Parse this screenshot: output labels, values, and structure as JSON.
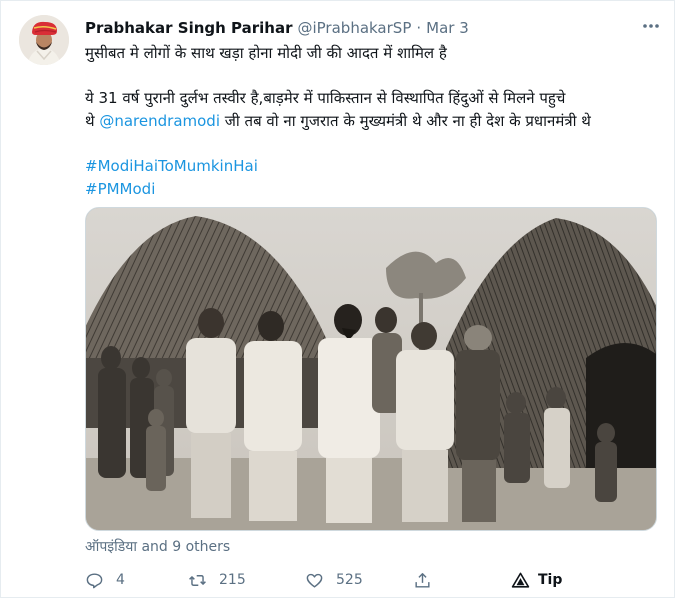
{
  "tweet": {
    "author_name": "Prabhakar Singh Parihar",
    "handle": "@iPrabhakarSP",
    "separator": "·",
    "date": "Mar 3",
    "text_line1": "मुसीबत मे लोगों के साथ खड़ा होना मोदी जी की आदत में शामिल है",
    "text_line2": "ये 31 वर्ष पुरानी दुर्लभ तस्वीर है,बाड़मेर में पाकिस्तान से विस्थापित हिंदुओं से मिलने पहुचे",
    "text_line3_prefix": "थे ",
    "mention": "@narendramodi",
    "text_line3_suffix": " जी तब वो ना गुजरात के मुख्यमंत्री थे और ना ही देश के प्रधानमंत्री थे",
    "hashtags": [
      "#ModiHaiToMumkinHai",
      "#PMModi"
    ],
    "tagged": "ऑपइंडिया and 9 others"
  },
  "actions": {
    "reply_count": "4",
    "retweet_count": "215",
    "like_count": "525",
    "tip_label": "Tip"
  },
  "icons": {
    "more": "more-icon",
    "reply": "reply-icon",
    "retweet": "retweet-icon",
    "like": "like-icon",
    "share": "share-icon",
    "tip": "tip-icon"
  },
  "colors": {
    "link": "#1b95e0",
    "secondary_text": "#5b7083",
    "primary_text": "#0f1419"
  }
}
